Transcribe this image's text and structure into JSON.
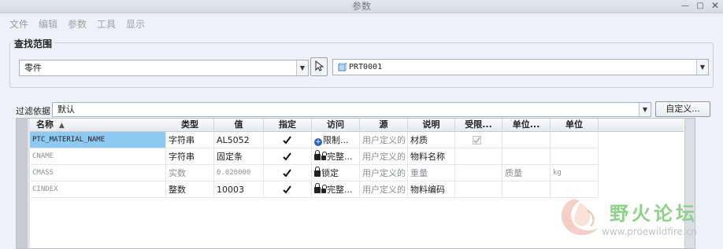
{
  "window": {
    "title": "参数"
  },
  "menu": [
    "文件",
    "编辑",
    "参数",
    "工具",
    "显示"
  ],
  "scope": {
    "group_title": "查找范围",
    "type_value": "零件",
    "object_value": "PRT0001"
  },
  "filter": {
    "label": "过滤依据",
    "value": "默认",
    "customize_label": "自定义..."
  },
  "table": {
    "columns": [
      "名称",
      "类型",
      "值",
      "指定",
      "访问",
      "源",
      "说明",
      "受限...",
      "单位...",
      "单位"
    ],
    "sort_indicator": "▲",
    "rows": [
      {
        "name": "PTC_MATERIAL_NAME",
        "type": "字符串",
        "value": "AL5052",
        "designate": true,
        "access": "限制...",
        "source": "用户定义的",
        "description": "材质",
        "restricted": true,
        "unit_dim": "",
        "unit": ""
      },
      {
        "name": "CNAME",
        "type": "字符串",
        "value": "固定条",
        "designate": true,
        "access": "完整...",
        "source": "用户定义的",
        "description": "物料名称",
        "restricted": false,
        "unit_dim": "",
        "unit": ""
      },
      {
        "name": "CMASS",
        "type": "实数",
        "value": "0.020000",
        "designate": true,
        "access": "锁定",
        "source": "用户定义的",
        "description": "重量",
        "restricted": false,
        "unit_dim": "质量",
        "unit": "kg"
      },
      {
        "name": "CINDEX",
        "type": "整数",
        "value": "10003",
        "designate": true,
        "access": "完整...",
        "source": "用户定义的",
        "description": "物料编码",
        "restricted": false,
        "unit_dim": "",
        "unit": ""
      }
    ]
  },
  "watermark": {
    "text_cn": "野火论坛",
    "text_url": "www.proewildfire.cn"
  },
  "colors": {
    "selection": "#8ec9f1",
    "window_bg": "#eef2f8",
    "watermark_green": "#8fd08a"
  }
}
